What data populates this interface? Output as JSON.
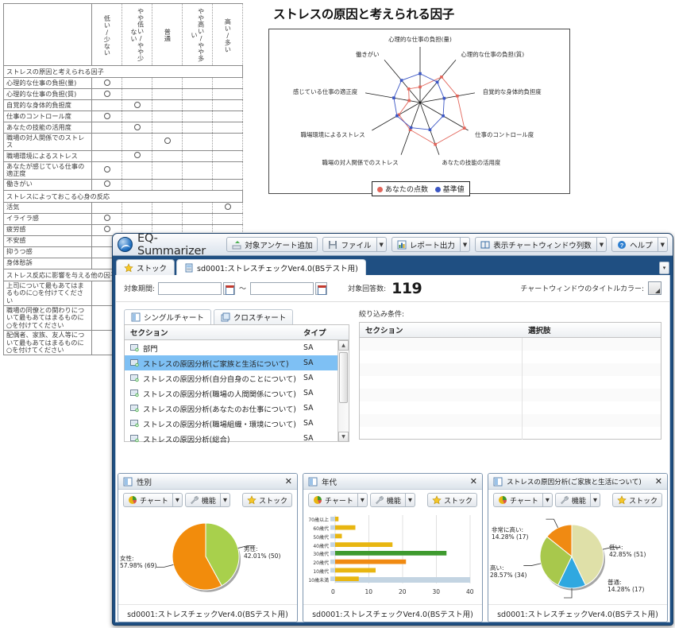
{
  "sheet": {
    "columns": [
      "低い/少ない",
      "やや低い/やや少ない",
      "普通",
      "やや高い/やや多い",
      "高い/多い"
    ],
    "sections": [
      {
        "title": "ストレスの原因と考えられる因子",
        "rows": [
          {
            "label": "心理的な仕事の負担(量)",
            "mark": 0
          },
          {
            "label": "心理的な仕事の負担(質)",
            "mark": 0
          },
          {
            "label": "自覚的な身体的負担度",
            "mark": 1
          },
          {
            "label": "仕事のコントロール度",
            "mark": 0
          },
          {
            "label": "あなたの技能の活用度",
            "mark": 1
          },
          {
            "label": "職場の対人関係でのストレス",
            "mark": 2
          },
          {
            "label": "職場環境によるストレス",
            "mark": 1
          },
          {
            "label": "あなたが感じている仕事の適正度",
            "mark": 0
          },
          {
            "label": "働きがい",
            "mark": 0
          }
        ]
      },
      {
        "title": "ストレスによっておこる心身の反応",
        "rows": [
          {
            "label": "活気",
            "mark": 4
          },
          {
            "label": "イライラ感",
            "mark": 0
          },
          {
            "label": "疲労感",
            "mark": 0
          },
          {
            "label": "不安感",
            "mark": -1
          },
          {
            "label": "抑うつ感",
            "mark": -1
          },
          {
            "label": "身体愁訴",
            "mark": -1
          }
        ]
      },
      {
        "title": "ストレス反応に影響を与える他の因子",
        "rows": [
          {
            "label": "上司について最もあてはまるものに○を付けてください",
            "mark": -1
          },
          {
            "label": "職場の同僚との関わりについて最もあてはまるものに○を付けてください",
            "mark": -1
          },
          {
            "label": "配偶者、家族、友人等について最もあてはまるものに○を付けてください",
            "mark": -1
          }
        ]
      }
    ]
  },
  "radar": {
    "title": "ストレスの原因と考えられる因子",
    "legend": [
      {
        "label": "あなたの点数",
        "color": "#e2655a"
      },
      {
        "label": "基準値",
        "color": "#3b56c4"
      }
    ],
    "axes": [
      "心理的な仕事の負担(量)",
      "心理的な仕事の負担(質)",
      "自覚的な身体的負担度",
      "仕事のコントロール度",
      "あなたの技能の活用度",
      "職場の対人関係でのストレス",
      "職場環境によるストレス",
      "感じている仕事の適正度",
      "働きがい"
    ],
    "chart_data": {
      "type": "radar",
      "title": "ストレスの原因と考えられる因子",
      "categories": [
        "心理的な仕事の負担(量)",
        "心理的な仕事の負担(質)",
        "自覚的な身体的負担度",
        "仕事のコントロール度",
        "あなたの技能の活用度",
        "職場の対人関係でのストレス",
        "職場環境によるストレス",
        "感じている仕事の適正度",
        "働きがい"
      ],
      "series": [
        {
          "name": "あなたの点数",
          "color": "#e2655a",
          "values": [
            14,
            30,
            34,
            46,
            40,
            26,
            22,
            10,
            16
          ]
        },
        {
          "name": "基準値",
          "color": "#3b56c4",
          "values": [
            26,
            24,
            22,
            24,
            26,
            24,
            24,
            24,
            26
          ]
        }
      ],
      "rmax": 50
    }
  },
  "app": {
    "title": "EQ-Summarizer",
    "toolbar": [
      {
        "name": "add-survey",
        "label": "対象アンケート追加",
        "icon": "upload-icon",
        "split": false
      },
      {
        "name": "file",
        "label": "ファイル",
        "icon": "save-icon",
        "split": true
      },
      {
        "name": "report-output",
        "label": "レポート出力",
        "icon": "report-icon",
        "split": true
      },
      {
        "name": "chart-window-columns",
        "label": "表示チャートウィンドウ列数",
        "icon": "layout-icon",
        "split": true
      },
      {
        "name": "help",
        "label": "ヘルプ",
        "icon": "help-icon",
        "split": true
      }
    ],
    "tabs": [
      {
        "label": "ストック",
        "icon": "star-icon",
        "active": false
      },
      {
        "label": "sd0001:ストレスチェックVer4.0(BSテスト用)",
        "icon": "survey-icon",
        "active": true
      }
    ],
    "tab_overflow": "▾",
    "filter": {
      "period_label": "対象期間:",
      "period_from": "",
      "period_to": "",
      "range_sep": "～",
      "count_label": "対象回答数:",
      "count_value": "119",
      "title_color_label": "チャートウィンドウのタイトルカラー:"
    },
    "chart_tabs": [
      {
        "label": "シングルチャート",
        "icon": "single-chart-icon",
        "active": true
      },
      {
        "label": "クロスチャート",
        "icon": "cross-chart-icon",
        "active": false
      }
    ],
    "section_grid": {
      "columns": [
        "セクション",
        "タイプ"
      ],
      "rows": [
        {
          "section": "部門",
          "type": "SA",
          "selected": false
        },
        {
          "section": "ストレスの原因分析(ご家族と生活について)",
          "type": "SA",
          "selected": true
        },
        {
          "section": "ストレスの原因分析(自分自身のことについて)",
          "type": "SA",
          "selected": false
        },
        {
          "section": "ストレスの原因分析(職場の人間関係について)",
          "type": "SA",
          "selected": false
        },
        {
          "section": "ストレスの原因分析(あなたのお仕事について)",
          "type": "SA",
          "selected": false
        },
        {
          "section": "ストレスの原因分析(職場組織・環境について)",
          "type": "SA",
          "selected": false
        },
        {
          "section": "ストレスの原因分析(総合)",
          "type": "SA",
          "selected": false
        }
      ]
    },
    "filter_grid": {
      "label": "絞り込み条件:",
      "columns": [
        "セクション",
        "選択肢"
      ],
      "rows": [
        {
          "section": "",
          "choice": ""
        },
        {
          "section": "",
          "choice": ""
        },
        {
          "section": "",
          "choice": ""
        },
        {
          "section": "",
          "choice": ""
        },
        {
          "section": "",
          "choice": ""
        },
        {
          "section": "",
          "choice": ""
        },
        {
          "section": "",
          "choice": ""
        },
        {
          "section": "",
          "choice": ""
        }
      ]
    }
  },
  "chart_windows": [
    {
      "name": "gender",
      "title": "性別",
      "close_label": "✕",
      "buttons": [
        {
          "name": "chart",
          "label": "チャート",
          "icon": "pie-icon",
          "split": true
        },
        {
          "name": "function",
          "label": "機能",
          "icon": "wrench-icon",
          "split": true
        },
        {
          "name": "stock",
          "label": "ストック",
          "icon": "star-icon",
          "split": false
        }
      ],
      "footer": "sd0001:ストレスチェックVer4.0(BSテスト用)",
      "chart_data": {
        "type": "pie",
        "title": "性別",
        "labels": [
          "男性",
          "女性"
        ],
        "percents": [
          "42.01%",
          "57.98%"
        ],
        "counts": [
          50,
          69
        ],
        "values": [
          42.01,
          57.98
        ],
        "colors": [
          "#a8d04c",
          "#f28c0c"
        ],
        "annotations": [
          "男性:\n42.01% (50)",
          "女性:\n57.98% (69)"
        ]
      }
    },
    {
      "name": "age",
      "title": "年代",
      "close_label": "✕",
      "buttons": [
        {
          "name": "chart",
          "label": "チャート",
          "icon": "pie-icon",
          "split": true
        },
        {
          "name": "function",
          "label": "機能",
          "icon": "wrench-icon",
          "split": true
        },
        {
          "name": "stock",
          "label": "ストック",
          "icon": "star-icon",
          "split": false
        }
      ],
      "footer": "sd0001:ストレスチェックVer4.0(BSテスト用)",
      "chart_data": {
        "type": "bar",
        "orientation": "horizontal",
        "title": "年代",
        "categories": [
          "70歳以上",
          "60歳代",
          "50歳代",
          "40歳代",
          "30歳代",
          "20歳代",
          "10歳代",
          "10歳未満"
        ],
        "values": [
          1,
          6,
          2,
          17,
          33,
          21,
          12,
          7
        ],
        "colors": [
          "#e8b611",
          "#e8b611",
          "#e8b611",
          "#e8b611",
          "#3e9a2e",
          "#f08a12",
          "#e8b611",
          "#e8b611"
        ],
        "xticks": [
          0,
          10,
          20,
          30,
          40
        ],
        "xlim": [
          0,
          40
        ],
        "xlabel": "",
        "ylabel": ""
      }
    },
    {
      "name": "stress-family",
      "title": "ストレスの原因分析(ご家族と生活について)",
      "close_label": "✕",
      "buttons": [
        {
          "name": "chart",
          "label": "チャート",
          "icon": "pie-icon",
          "split": true
        },
        {
          "name": "function",
          "label": "機能",
          "icon": "wrench-icon",
          "split": true
        },
        {
          "name": "stock",
          "label": "ストック",
          "icon": "star-icon",
          "split": false
        }
      ],
      "footer": "sd0001:ストレスチェックVer4.0(BSテスト用)",
      "chart_data": {
        "type": "pie",
        "title": "ストレスの原因分析(ご家族と生活について)",
        "labels": [
          "低い",
          "普通",
          "高い",
          "非常に高い"
        ],
        "percents": [
          "42.85%",
          "14.28%",
          "28.57%",
          "14.28%"
        ],
        "counts": [
          51,
          17,
          34,
          17
        ],
        "values": [
          42.85,
          14.28,
          28.57,
          14.28
        ],
        "colors": [
          "#dfe0a8",
          "#2fa8e0",
          "#a8c84c",
          "#f08a12"
        ],
        "annotations": [
          "低い:\n42.85% (51)",
          "普通:\n14.28% (17)",
          "高い:\n28.57% (34)",
          "非常に高い:\n14.28% (17)"
        ]
      }
    }
  ],
  "colors": {
    "window_frame": "#1f4f82",
    "selection": "#7ec0f4",
    "accent_orange": "#f28c0c",
    "accent_green": "#a8d04c"
  }
}
